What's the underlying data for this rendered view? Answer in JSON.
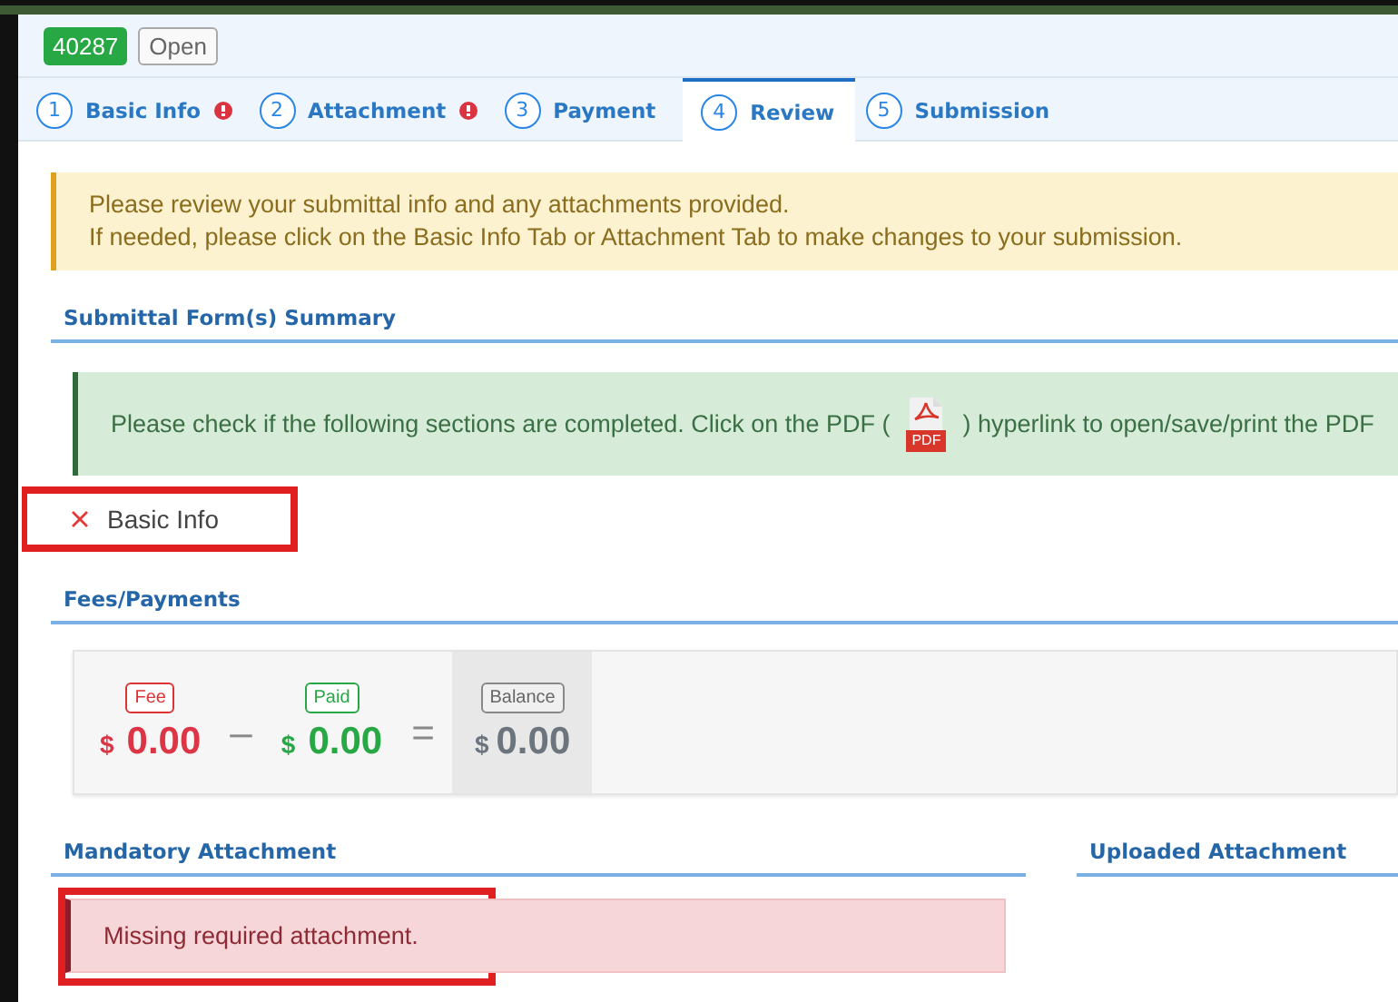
{
  "record": {
    "number": "40287",
    "status": "Open"
  },
  "tabs": [
    {
      "number": "1",
      "label": "Basic Info",
      "error": true,
      "selected": false
    },
    {
      "number": "2",
      "label": "Attachment",
      "error": true,
      "selected": false
    },
    {
      "number": "3",
      "label": "Payment",
      "error": false,
      "selected": false
    },
    {
      "number": "4",
      "label": "Review",
      "error": false,
      "selected": true
    },
    {
      "number": "5",
      "label": "Submission",
      "error": false,
      "selected": false
    }
  ],
  "notice": [
    "Please review your submittal info and any attachments provided.",
    "If needed, please click on the Basic Info Tab or Attachment Tab to make changes to your submission."
  ],
  "summary": {
    "title": "Submittal Form(s) Summary",
    "hint_before": "Please check if the following sections are completed. Click on the PDF (",
    "pdf_label": "PDF",
    "hint_after": ") hyperlink to open/save/print the PDF",
    "sections": [
      {
        "label": "Basic Info",
        "complete": false,
        "highlighted": true
      }
    ]
  },
  "fees": {
    "title": "Fees/Payments",
    "items": [
      {
        "kind": "fee",
        "tag": "Fee",
        "currency": "$",
        "amount": "0.00"
      },
      {
        "kind": "operator",
        "symbol": "–"
      },
      {
        "kind": "paid",
        "tag": "Paid",
        "currency": "$",
        "amount": "0.00"
      },
      {
        "kind": "operator",
        "symbol": "="
      },
      {
        "kind": "balance",
        "tag": "Balance",
        "currency": "$",
        "amount": "0.00"
      }
    ]
  },
  "mandatory": {
    "title": "Mandatory Attachment",
    "message": "Missing required attachment.",
    "highlighted": true
  },
  "uploaded": {
    "title": "Uploaded Attachment"
  }
}
